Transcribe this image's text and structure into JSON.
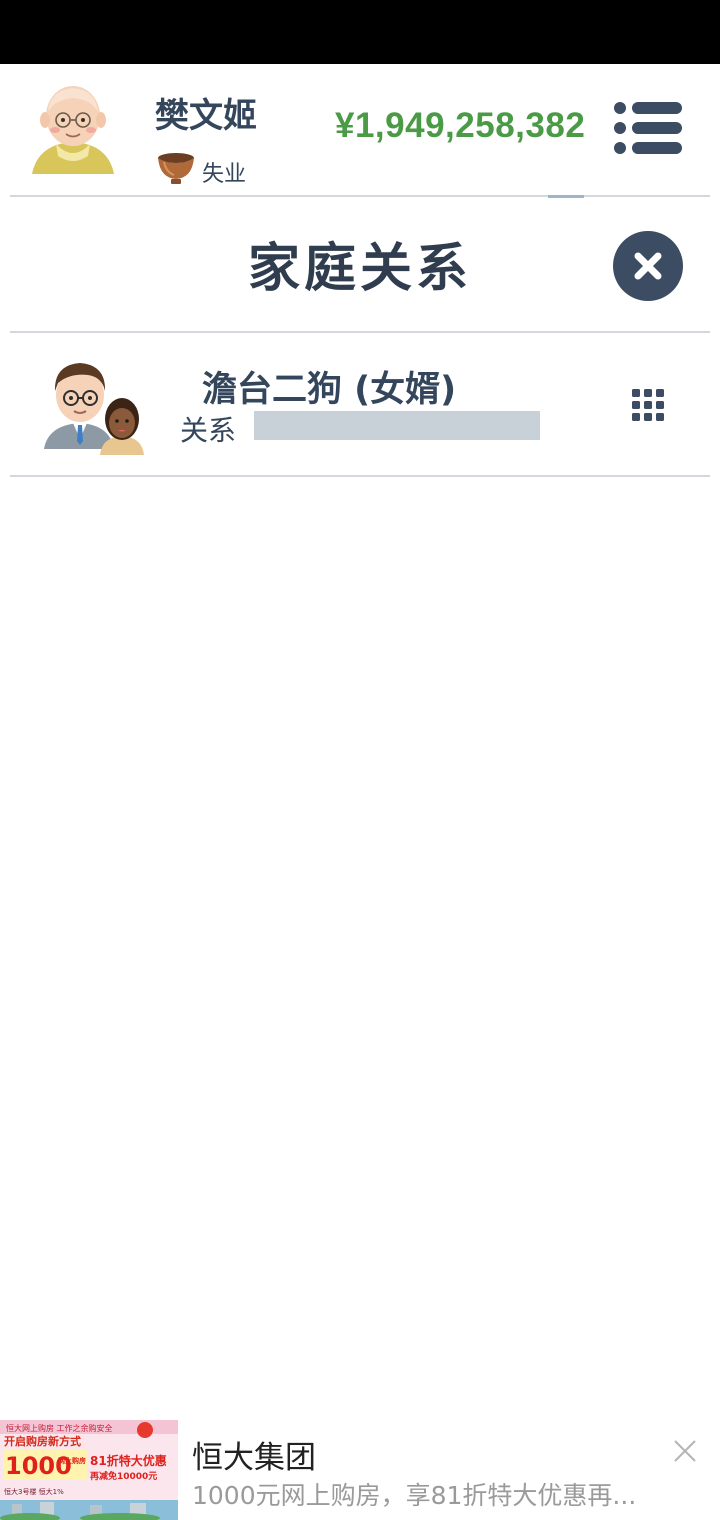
{
  "player": {
    "name": "樊文姬",
    "job": "失业",
    "money": "¥1,949,258,382"
  },
  "panel": {
    "title": "家庭关系"
  },
  "relations": [
    {
      "name": "澹台二狗 (女婿)",
      "relation_label": "关系",
      "relation_level": 0
    }
  ],
  "ad": {
    "title": "恒大集团",
    "description": "1000元网上购房，享81折特大优惠再...",
    "image_text": {
      "top": "恒大网上购房 工作之余购安全",
      "line2": "开启购房新方式",
      "amount": "1000",
      "online": "网上购房",
      "discount": "81折特大优惠",
      "reduce": "再减免10000元",
      "foot": "恒大3号楼 恒大1%"
    }
  },
  "colors": {
    "money": "#4a9a46",
    "text_dark": "#34465c",
    "close_bg": "#3b4c63",
    "relation_bar": "#c8d0d8"
  },
  "icons": {
    "menu": "list-icon",
    "close": "close-circle-icon",
    "row_menu": "grid-dots-icon",
    "job": "bowl-icon",
    "ad_close": "close-icon"
  }
}
